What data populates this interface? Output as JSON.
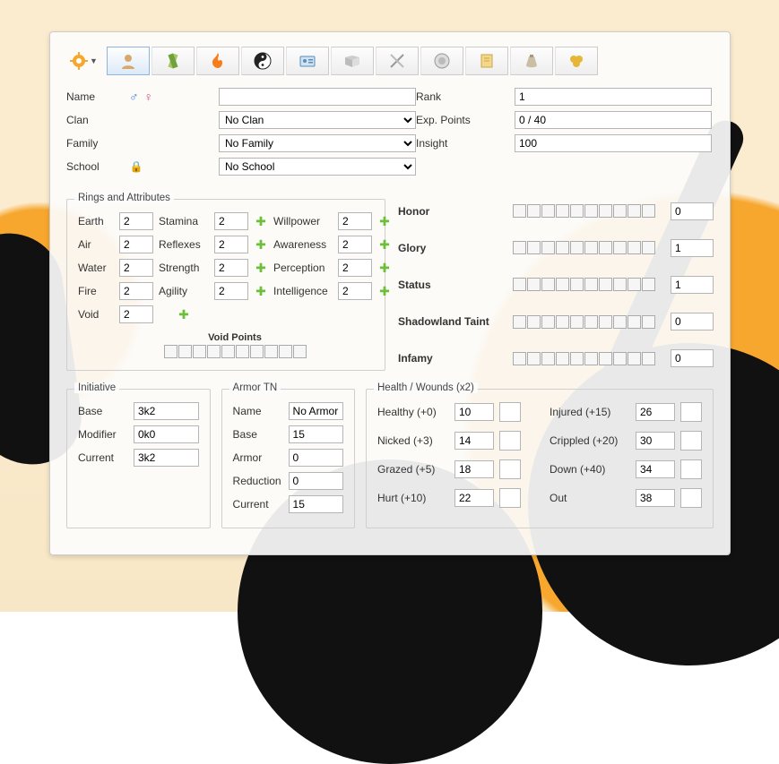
{
  "toolbar": {
    "tabs": [
      {
        "name": "settings-icon"
      },
      {
        "name": "character-icon",
        "active": true
      },
      {
        "name": "skills-icon"
      },
      {
        "name": "fire-icon"
      },
      {
        "name": "yinyang-icon"
      },
      {
        "name": "id-icon"
      },
      {
        "name": "book-icon"
      },
      {
        "name": "swords-icon"
      },
      {
        "name": "target-icon"
      },
      {
        "name": "scroll-icon"
      },
      {
        "name": "bag-icon"
      },
      {
        "name": "coins-icon"
      }
    ]
  },
  "form": {
    "name_label": "Name",
    "name_value": "",
    "clan_label": "Clan",
    "clan_value": "No Clan",
    "clan_options": [
      "No Clan"
    ],
    "family_label": "Family",
    "family_value": "No Family",
    "family_options": [
      "No Family"
    ],
    "school_label": "School",
    "school_value": "No School",
    "school_options": [
      "No School"
    ],
    "rank_label": "Rank",
    "rank_value": "1",
    "exp_label": "Exp. Points",
    "exp_value": "0 / 40",
    "insight_label": "Insight",
    "insight_value": "100"
  },
  "rings": {
    "title": "Rings and Attributes",
    "rows": [
      {
        "ring": "Earth",
        "ring_val": "2",
        "attr1": "Stamina",
        "a1": "2",
        "attr2": "Willpower",
        "a2": "2"
      },
      {
        "ring": "Air",
        "ring_val": "2",
        "attr1": "Reflexes",
        "a1": "2",
        "attr2": "Awareness",
        "a2": "2"
      },
      {
        "ring": "Water",
        "ring_val": "2",
        "attr1": "Strength",
        "a1": "2",
        "attr2": "Perception",
        "a2": "2"
      },
      {
        "ring": "Fire",
        "ring_val": "2",
        "attr1": "Agility",
        "a1": "2",
        "attr2": "Intelligence",
        "a2": "2"
      }
    ],
    "void_label": "Void",
    "void_val": "2",
    "void_points_label": "Void Points",
    "void_pips": 10
  },
  "stats": {
    "honor_label": "Honor",
    "honor_val": "0",
    "glory_label": "Glory",
    "glory_val": "1",
    "status_label": "Status",
    "status_val": "1",
    "taint_label": "Shadowland Taint",
    "taint_val": "0",
    "infamy_label": "Infamy",
    "infamy_val": "0",
    "pips": 10
  },
  "initiative": {
    "title": "Initiative",
    "base_label": "Base",
    "base": "3k2",
    "mod_label": "Modifier",
    "mod": "0k0",
    "cur_label": "Current",
    "cur": "3k2"
  },
  "armor": {
    "title": "Armor TN",
    "name_label": "Name",
    "name": "No Armor",
    "base_label": "Base",
    "base": "15",
    "armor_label": "Armor",
    "armor": "0",
    "red_label": "Reduction",
    "red": "0",
    "cur_label": "Current",
    "cur": "15"
  },
  "health": {
    "title": "Health / Wounds (x2)",
    "rows": [
      {
        "l1": "Healthy (+0)",
        "v1": "10",
        "l2": "Injured (+15)",
        "v2": "26"
      },
      {
        "l1": "Nicked (+3)",
        "v1": "14",
        "l2": "Crippled (+20)",
        "v2": "30"
      },
      {
        "l1": "Grazed (+5)",
        "v1": "18",
        "l2": "Down (+40)",
        "v2": "34"
      },
      {
        "l1": "Hurt (+10)",
        "v1": "22",
        "l2": "Out",
        "v2": "38"
      }
    ]
  }
}
